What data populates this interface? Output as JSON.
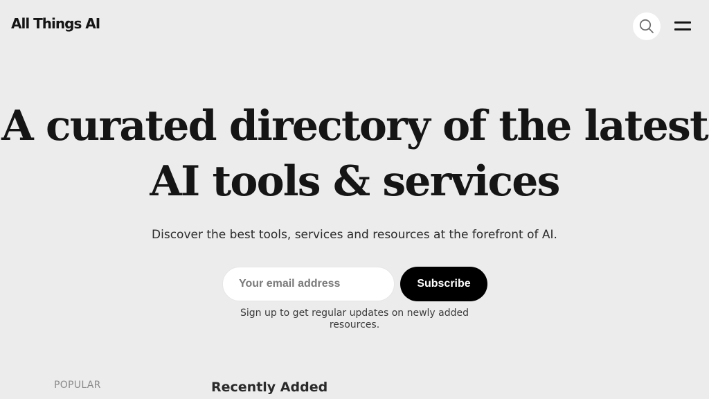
{
  "header": {
    "logo": "All Things AI",
    "search_icon": "search-icon",
    "menu_icon": "hamburger-menu-icon"
  },
  "hero": {
    "title_line1": "A curated directory of the latest",
    "title_line2": "AI tools & services",
    "subtitle": "Discover the best tools, services and resources at the forefront of AI."
  },
  "subscribe": {
    "email_placeholder": "Your email address",
    "email_value": "",
    "button_label": "Subscribe",
    "note": "Sign up to get regular updates on newly added resources."
  },
  "sections": {
    "popular_label": "POPULAR",
    "recent_heading": "Recently Added"
  },
  "colors": {
    "background": "#ececec",
    "text": "#151515",
    "button_bg": "#000000",
    "button_text": "#ffffff"
  }
}
